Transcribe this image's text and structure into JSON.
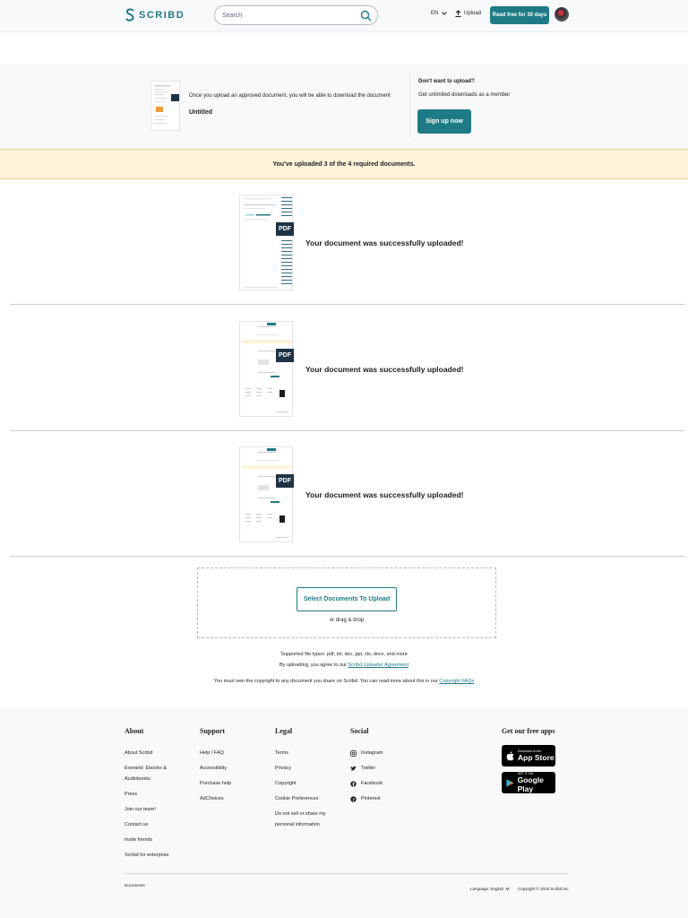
{
  "header": {
    "logo_text": "SCRIBD",
    "search_placeholder": "Search",
    "language": "EN",
    "upload_label": "Upload",
    "cta_label": "Read free for 30 days"
  },
  "banner": {
    "message": "Once you upload an approved document, you will be able to download the document",
    "doc_title": "Untitled",
    "dont_want": "Don't want to upload?",
    "unlimited": "Get unlimited downloads as a member",
    "signup_label": "Sign up now"
  },
  "notice": "You've uploaded 3 of the 4 required documents.",
  "uploads": [
    {
      "tag": "PDF",
      "message": "Your document was successfully uploaded!"
    },
    {
      "tag": "PDF",
      "message": "Your document was successfully uploaded!"
    },
    {
      "tag": "PDF",
      "message": "Your document was successfully uploaded!"
    }
  ],
  "upload_box": {
    "select_label": "Select Documents To Upload",
    "drag_label": "or drag & drop"
  },
  "notes": {
    "supported": "Supported file types: pdf, txt, doc, ppt, xls, docx, and more",
    "agree_prefix": "By uploading, you agree to our ",
    "agree_link": "Scribd Uploader Agreement",
    "copyright_prefix": "You must own the copyright to any document you share on Scribd. You can read more about this in our ",
    "copyright_link": "Copyright FAQs"
  },
  "footer": {
    "about": {
      "title": "About",
      "items": [
        "About Scribd",
        "Everand: Ebooks & Audiobooks",
        "Press",
        "Join our team!",
        "Contact us",
        "Invite friends",
        "Scribd for enterprise"
      ]
    },
    "support": {
      "title": "Support",
      "items": [
        "Help / FAQ",
        "Accessibility",
        "Purchase help",
        "AdChoices"
      ]
    },
    "legal": {
      "title": "Legal",
      "items": [
        "Terms",
        "Privacy",
        "Copyright",
        "Cookie Preferences",
        "Do not sell or share my personal information"
      ]
    },
    "social": {
      "title": "Social",
      "items": [
        "Instagram",
        "Twitter",
        "Facebook",
        "Pinterest"
      ]
    },
    "apps": {
      "title": "Get our free apps",
      "appstore_small": "Download on the",
      "appstore_big": "App Store",
      "googleplay_small": "GET IT ON",
      "googleplay_big": "Google Play"
    },
    "documents_link": "Documents",
    "language": "Language: English",
    "copyright": "Copyright © 2025 Scribd Inc."
  },
  "colors": {
    "accent": "#1e7b85",
    "notice_bg": "#fcf3d9",
    "pdf_tag": "#1f3244"
  }
}
